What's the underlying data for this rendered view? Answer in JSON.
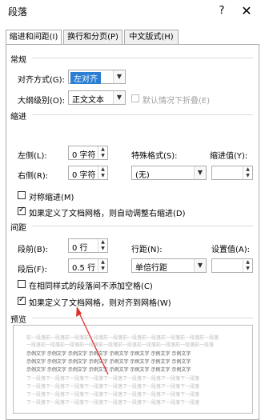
{
  "window": {
    "title": "段落",
    "help_icon": "?",
    "close_icon": "✕"
  },
  "tabs": [
    {
      "label": "缩进和间距(I)",
      "active": true
    },
    {
      "label": "换行和分页(P)",
      "active": false
    },
    {
      "label": "中文版式(H)",
      "active": false
    }
  ],
  "general": {
    "section_label": "常规",
    "alignment_label": "对齐方式(G):",
    "alignment_value": "左对齐",
    "outline_label": "大纲级别(O):",
    "outline_value": "正文文本",
    "collapse_label": "默认情况下折叠(E)"
  },
  "indent": {
    "section_label": "缩进",
    "left_label": "左侧(L):",
    "left_value": "0 字符",
    "right_label": "右侧(R):",
    "right_value": "0 字符",
    "special_label": "特殊格式(S):",
    "special_value": "(无)",
    "indent_value_label": "缩进值(Y):",
    "mirror_label": "对称缩进(M)",
    "auto_adjust_label": "如果定义了文档网格，则自动调整右缩进(D)"
  },
  "spacing": {
    "section_label": "间距",
    "before_label": "段前(B):",
    "before_value": "0 行",
    "after_label": "段后(F):",
    "after_value": "0.5 行",
    "line_spacing_label": "行距(N):",
    "line_spacing_value": "单倍行距",
    "setting_label": "设置值(A):",
    "no_space_label": "在相同样式的段落间不添加空格(C)",
    "snap_grid_label": "如果定义了文档网格，则对齐到网格(W)"
  },
  "preview": {
    "section_label": "预览",
    "grey_line_1": "前一段落前一段落前一段落前一段落前一段落前一段落前一段落前一段落前一段落前一段落",
    "grey_line_2": "一段落前一段落前一段落前一段落前一段落前一段落前一段落前一段落前一段落前一段落",
    "sample_line": "示例文字 示例文字 示例文字 示例文字 示例文字 示例文字 示例文字 示例文字",
    "grey_line_3": "下一段落下一段落下一段落下一段落下一段落下一段落下一段落下一段落下一段落"
  },
  "colors": {
    "annotation_arrow": "#e0302a",
    "selection": "#2a7ed3"
  }
}
